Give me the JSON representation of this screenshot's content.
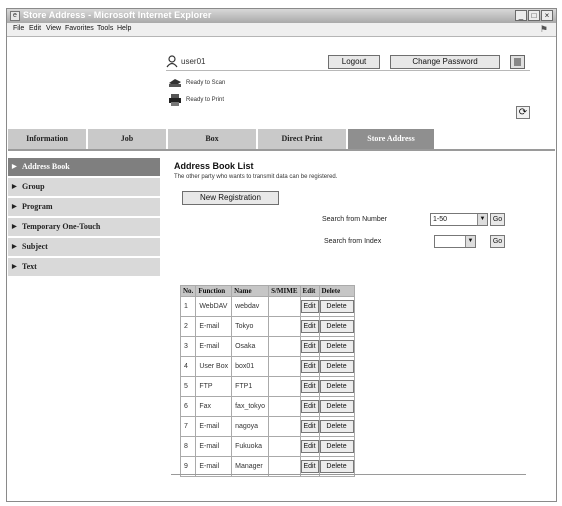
{
  "window": {
    "title": "Store Address - Microsoft Internet Explorer"
  },
  "menu": [
    "File",
    "Edit",
    "View",
    "Favorites",
    "Tools",
    "Help"
  ],
  "header": {
    "user": "user01",
    "logout": "Logout",
    "change_password": "Change Password",
    "status_scan": "Ready to Scan",
    "status_print": "Ready to Print"
  },
  "tabs": [
    "Information",
    "Job",
    "Box",
    "Direct Print",
    "Store Address"
  ],
  "sidebar": [
    "Address Book",
    "Group",
    "Program",
    "Temporary One-Touch",
    "Subject",
    "Text"
  ],
  "main": {
    "title": "Address Book List",
    "description": "The other party who wants to transmit data can be registered.",
    "new_registration": "New Registration",
    "search_number_label": "Search from Number",
    "search_number_value": "1-50",
    "search_index_label": "Search from Index",
    "search_index_value": "",
    "go": "Go"
  },
  "table": {
    "headers": [
      "No.",
      "Function",
      "Name",
      "S/MIME",
      "Edit",
      "Delete"
    ],
    "edit_label": "Edit",
    "delete_label": "Delete",
    "rows": [
      {
        "no": "1",
        "function": "WebDAV",
        "name": "webdav"
      },
      {
        "no": "2",
        "function": "E-mail",
        "name": "Tokyo"
      },
      {
        "no": "3",
        "function": "E-mail",
        "name": "Osaka"
      },
      {
        "no": "4",
        "function": "User Box",
        "name": "box01"
      },
      {
        "no": "5",
        "function": "FTP",
        "name": "FTP1"
      },
      {
        "no": "6",
        "function": "Fax",
        "name": "fax_tokyo"
      },
      {
        "no": "7",
        "function": "E-mail",
        "name": "nagoya"
      },
      {
        "no": "8",
        "function": "E-mail",
        "name": "Fukuoka"
      },
      {
        "no": "9",
        "function": "E-mail",
        "name": "Manager"
      }
    ]
  }
}
